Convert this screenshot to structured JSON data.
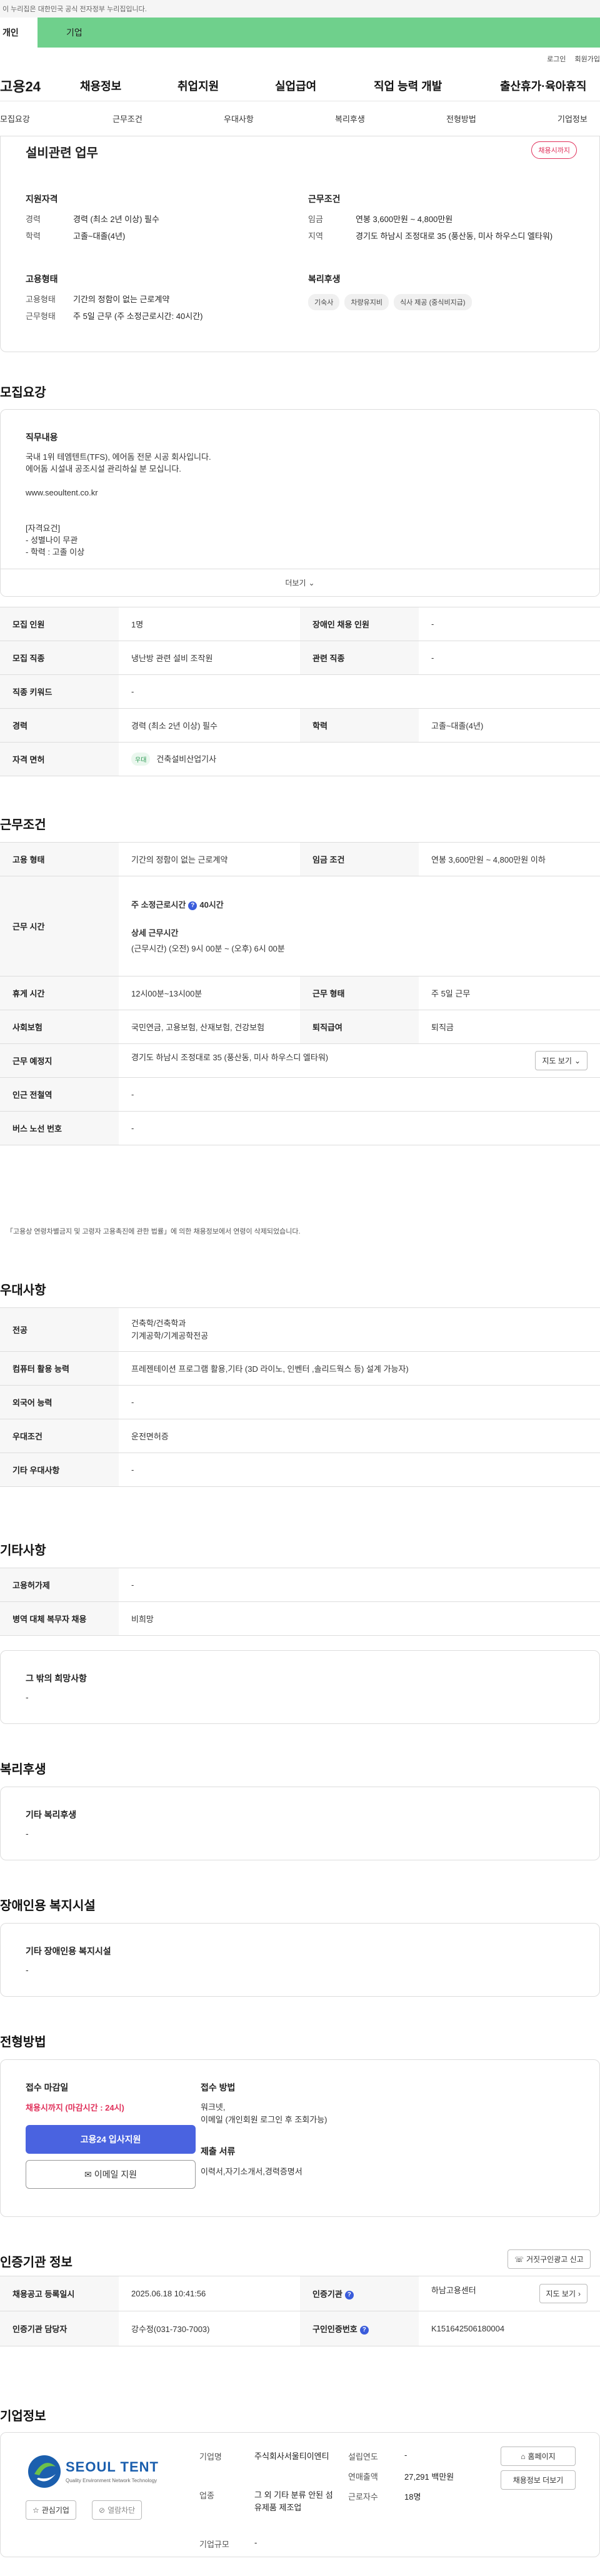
{
  "gov_notice": "이 누리집은 대한민국 공식 전자정부 누리집입니다.",
  "usertype": {
    "personal": "개인",
    "company": "기업"
  },
  "topmenu": {
    "login": "로그인",
    "join": "회원가입"
  },
  "gnb": {
    "logo": "고용24",
    "menus": [
      "채용정보",
      "취업지원",
      "실업급여",
      "직업 능력 개발",
      "출산휴가·육아휴직"
    ]
  },
  "subnav": [
    "모집요강",
    "근무조건",
    "우대사항",
    "복리후생",
    "전형방법",
    "기업정보"
  ],
  "summary": {
    "title": "설비관련 업무",
    "status": "채용시까지",
    "qual_head": "지원자격",
    "qual": [
      {
        "k": "경력",
        "v": "경력 (최소 2년 이상) 필수"
      },
      {
        "k": "학력",
        "v": "고졸~대졸(4년)"
      }
    ],
    "cond_head": "근무조건",
    "cond": [
      {
        "k": "임금",
        "v": "연봉 3,600만원 ~ 4,800만원"
      },
      {
        "k": "지역",
        "v": "경기도 하남시 조정대로 35 (풍산동, 미사 하우스디 엘타워)"
      }
    ],
    "emp_head": "고용형태",
    "emp": [
      {
        "k": "고용형태",
        "v": "기간의 정함이 없는 근로계약"
      },
      {
        "k": "근무형태",
        "v": "주 5일 근무 (주 소정근로시간: 40시간)"
      }
    ],
    "welfare_head": "복리후생",
    "welfare_tags": [
      "기숙사",
      "차량유지비",
      "식사 제공 (중식비지급)"
    ]
  },
  "recruit": {
    "section_title": "모집요강",
    "job_head": "직무내용",
    "job_text": "국내 1위 테엠텐트(TFS), 에어돔 전문 시공 회사입니다.\n에어돔 시설내 공조시설 관리하실 분 모십니다.\n\nwww.seoultent.co.kr\n\n\n[자격요건]\n- 성별나이 무관\n- 학력 : 고졸 이상",
    "more": "더보기",
    "rows": [
      {
        "k1": "모집 인원",
        "v1": "1명",
        "k2": "장애인 채용 인원",
        "v2": "-"
      },
      {
        "k1": "모집 직종",
        "v1": "냉난방 관련 설비 조작원",
        "k2": "관련 직종",
        "v2": "-"
      },
      {
        "k1": "직종 키워드",
        "v1": "-"
      },
      {
        "k1": "경력",
        "v1": "경력 (최소 2년 이상) 필수",
        "k2": "학력",
        "v2": "고졸~대졸(4년)"
      },
      {
        "k1": "자격 면허",
        "badge": "우대",
        "v1": "건축설비산업기사"
      }
    ]
  },
  "work": {
    "section_title": "근무조건",
    "emp_k": "고용 형태",
    "emp_v": "기간의 정함이 없는 근로계약",
    "wage_k": "임금 조건",
    "wage_v": "연봉 3,600만원 ~ 4,800만원 이하",
    "hours_k": "근무 시간",
    "hours_main": "주 소정근로시간",
    "hours_main_v": "40시간",
    "hours_detail_head": "상세 근무시간",
    "hours_detail_1": "(근무시간) (오전) 9시 00분 ~ (오후) 6시 00분",
    "break_k": "휴게 시간",
    "break_v": "12시00분~13시00분",
    "form_k": "근무 형태",
    "form_v": "주 5일 근무",
    "ins_k": "사회보험",
    "ins_v": "국민연금, 고용보험, 산재보험, 건강보험",
    "ret_k": "퇴직급여",
    "ret_v": "퇴직금",
    "place_k": "근무 예정지",
    "place_v": "경기도 하남시 조정대로 35 (풍산동, 미사 하우스디 엘타워)",
    "map_btn": "지도 보기",
    "subway_k": "인근 전철역",
    "subway_v": "-",
    "bus_k": "버스 노선 번호",
    "bus_v": "-",
    "note": "「고용상 연령차별금지 및 고령자 고용촉진에 관한 법률」에 의한 채용정보에서 연령이 삭제되었습니다."
  },
  "pref": {
    "section_title": "우대사항",
    "rows": [
      {
        "k": "전공",
        "v": "건축학/건축학과\n기계공학/기계공학전공"
      },
      {
        "k": "컴퓨터 활용 능력",
        "v": "프레젠테이션 프로그램 활용,기타 (3D 라이노, 인벤터 ,솔리드웍스 등) 설계 가능자)"
      },
      {
        "k": "외국어 능력",
        "v": "-"
      },
      {
        "k": "우대조건",
        "v": "운전면허증"
      },
      {
        "k": "기타 우대사항",
        "v": "-"
      }
    ]
  },
  "etc": {
    "section_title": "기타사항",
    "rows": [
      {
        "k": "고용허가제",
        "v": "-"
      },
      {
        "k": "병역 대체 복무자 채용",
        "v": "비희망"
      }
    ],
    "other_head": "그 밖의 희망사항",
    "other_v": "-"
  },
  "welfare": {
    "section_title": "복리후생",
    "head": "기타 복리후생",
    "v": "-"
  },
  "disability": {
    "section_title": "장애인용 복지시설",
    "head": "기타 장애인용 복지시설",
    "v": "-"
  },
  "process": {
    "section_title": "전형방법",
    "deadline_head": "접수 마감일",
    "deadline_v": "채용시까지 (마감시간 : 24시)",
    "apply_btn": "고용24 입사지원",
    "email_btn": "이메일 지원",
    "method_head": "접수 방법",
    "method_v": "워크넷,\n이메일 (개인회원 로그인 후 조회가능)",
    "docs_head": "제출 서류",
    "docs_v": "이력서,자기소개서,경력증명서"
  },
  "cert": {
    "section_title": "인증기관 정보",
    "report_btn": "거짓구인광고 신고",
    "reg_k": "채용공고 등록일시",
    "reg_v": "2025.06.18 10:41:56",
    "org_k": "인증기관",
    "org_v": "하남고용센터",
    "map_btn": "지도 보기",
    "mgr_k": "인증기관 담당자",
    "mgr_v": "강수정(031-730-7003)",
    "id_k": "구인인증번호",
    "id_v": "K151642506180004"
  },
  "company": {
    "section_title": "기업정보",
    "logo_text": "SEOUL TENT",
    "logo_sub": "Quality Environment Network Technology",
    "fav_btn": "관심기업",
    "block_btn": "열람차단",
    "name_k": "기업명",
    "name_v": "주식회사서울티이엔티",
    "ind_k": "업종",
    "ind_v": "그 외 기타 분류 안된 섬유제품 제조업",
    "scale_k": "기업규모",
    "scale_v": "-",
    "est_k": "설립연도",
    "est_v": "-",
    "sales_k": "연매출액",
    "sales_v": "27,291 백만원",
    "emp_k": "근로자수",
    "emp_v": "18명",
    "home_btn": "홈페이지",
    "info_btn": "채용정보 더보기"
  },
  "colors": {
    "accent": "#4a63e0",
    "green": "#6fd08c",
    "red": "#e0305a"
  }
}
